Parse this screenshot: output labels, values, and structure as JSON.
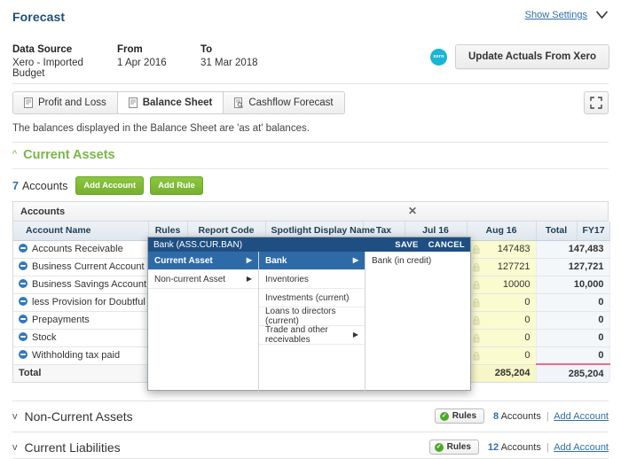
{
  "header": {
    "title": "Forecast",
    "show_settings": "Show Settings",
    "chevron_icon": "chevron-down-icon"
  },
  "meta": {
    "data_source_label": "Data Source",
    "data_source_value": "Xero - Imported Budget",
    "from_label": "From",
    "from_value": "1 Apr 2016",
    "to_label": "To",
    "to_value": "31 Mar 2018",
    "xero_logo_text": "xero",
    "update_button": "Update Actuals From Xero"
  },
  "tabs": [
    {
      "label": "Profit and Loss",
      "icon": "document-icon",
      "active": false
    },
    {
      "label": "Balance Sheet",
      "icon": "document-icon",
      "active": true
    },
    {
      "label": "Cashflow Forecast",
      "icon": "document-search-icon",
      "active": false
    }
  ],
  "expand_icon": "fullscreen-expand-icon",
  "note": "The balances displayed in the Balance Sheet are 'as at' balances.",
  "section": {
    "caret": "^",
    "title": "Current Assets",
    "account_count": "7",
    "accounts_word": "Accounts",
    "add_account_button": "Add Account",
    "add_rule_button": "Add Rule"
  },
  "table": {
    "panel_title": "Accounts",
    "close_icon": "close-icon",
    "columns": [
      "Account Name",
      "Rules",
      "Report Code",
      "Spotlight Display Name",
      "Tax",
      "Jul 16",
      "Aug 16",
      "Total",
      "FY17"
    ],
    "rows": [
      {
        "name": "Accounts Receivable",
        "aug": "147483",
        "total": "147,483"
      },
      {
        "name": "Business Current Account",
        "aug": "127721",
        "total": "127,721"
      },
      {
        "name": "Business Savings Account",
        "aug": "10000",
        "total": "10,000"
      },
      {
        "name": "less Provision for Doubtful Debt",
        "aug": "0",
        "total": "0"
      },
      {
        "name": "Prepayments",
        "aug": "0",
        "total": "0"
      },
      {
        "name": "Stock",
        "aug": "0",
        "total": "0"
      },
      {
        "name": "Withholding tax paid",
        "aug": "0",
        "total": "0"
      }
    ],
    "total_row": {
      "label": "Total",
      "aug": "285,204",
      "total": "285,204"
    },
    "lock_icon": "lock-icon",
    "bullet_icon": "minus-circle-icon"
  },
  "menu": {
    "title": "Bank (ASS.CUR.BAN)",
    "save_label": "SAVE",
    "cancel_label": "CANCEL",
    "column_one": [
      {
        "label": "Current Asset",
        "selected": true,
        "has_submenu": true
      },
      {
        "label": "Non-current Asset",
        "selected": false,
        "has_submenu": true
      }
    ],
    "column_two": [
      {
        "label": "Bank",
        "selected": true,
        "has_submenu": true
      },
      {
        "label": "Inventories",
        "selected": false,
        "has_submenu": false
      },
      {
        "label": "Investments (current)",
        "selected": false,
        "has_submenu": false
      },
      {
        "label": "Loans to directors (current)",
        "selected": false,
        "has_submenu": false
      },
      {
        "label": "Trade and other receivables",
        "selected": false,
        "has_submenu": true
      }
    ],
    "column_three": [
      {
        "label": "Bank (in credit)",
        "selected": false,
        "has_submenu": false
      }
    ]
  },
  "footer_sections": [
    {
      "caret": "v",
      "title": "Non-Current Assets",
      "rules_label": "Rules",
      "check_icon": "check-circle-icon",
      "count": "8",
      "accounts_word": "Accounts",
      "separator": "|",
      "add_account": "Add Account"
    },
    {
      "caret": "v",
      "title": "Current Liabilities",
      "rules_label": "Rules",
      "check_icon": "check-circle-icon",
      "count": "12",
      "accounts_word": "Accounts",
      "separator": "|",
      "add_account": "Add Account"
    }
  ],
  "colors": {
    "brand_blue": "#1f4e79",
    "link_blue": "#2f6fa8",
    "section_green": "#7ab648",
    "button_green": "#8dc63f",
    "editable_yellow": "#fbfbd0",
    "menu_select_blue": "#2f6aa8",
    "total_underline_pink": "#f06b8a"
  }
}
